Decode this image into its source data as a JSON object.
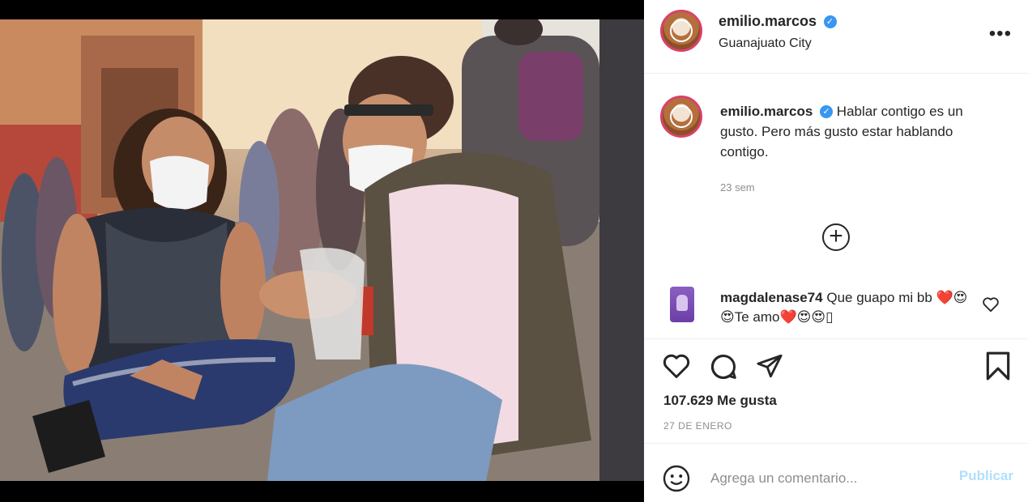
{
  "post": {
    "username": "emilio.marcos",
    "location": "Guanajuato City",
    "verified_icon": "verified-badge-icon",
    "more_icon": "more-options-icon"
  },
  "caption": {
    "username": "emilio.marcos",
    "text": "Hablar contigo es un gusto. Pero más gusto estar hablando contigo.",
    "time": "23 sem"
  },
  "load_more_icon": "plus-circle-icon",
  "comment": {
    "username": "magdalenase74",
    "text": "Que guapo mi bb ❤️😍😍Te amo❤️😍😍▯",
    "like_icon": "heart-outline-icon"
  },
  "actions": {
    "like_icon": "heart-icon",
    "comment_icon": "comment-icon",
    "share_icon": "send-icon",
    "save_icon": "bookmark-icon"
  },
  "likes": "107.629 Me gusta",
  "date": "27 DE ENERO",
  "add_comment": {
    "emoji_icon": "emoji-icon",
    "placeholder": "Agrega un comentario...",
    "publish_label": "Publicar"
  },
  "colors": {
    "accent": "#3897f0",
    "publish_disabled": "#b2dffc",
    "like_red": "#ed4956"
  }
}
